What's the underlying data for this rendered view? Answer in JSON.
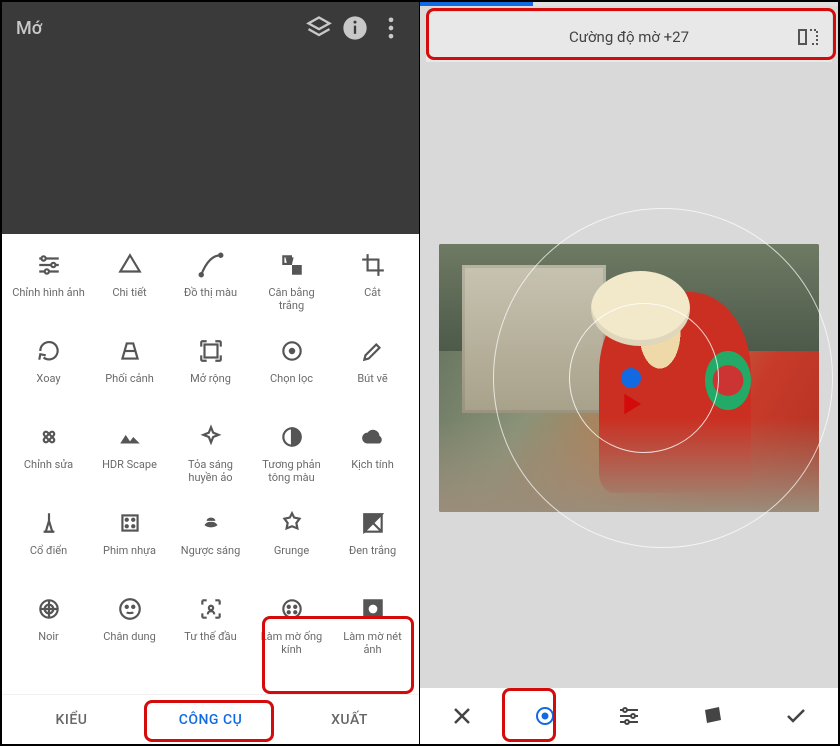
{
  "left": {
    "title": "Mớ",
    "tools": [
      {
        "label": "Chỉnh hình ảnh",
        "name": "tune-image"
      },
      {
        "label": "Chi tiết",
        "name": "details"
      },
      {
        "label": "Đồ thị màu",
        "name": "curves"
      },
      {
        "label": "Cân bằng trắng",
        "name": "white-balance"
      },
      {
        "label": "Cắt",
        "name": "crop"
      },
      {
        "label": "Xoay",
        "name": "rotate"
      },
      {
        "label": "Phối cảnh",
        "name": "perspective"
      },
      {
        "label": "Mở rộng",
        "name": "expand"
      },
      {
        "label": "Chọn lọc",
        "name": "selective"
      },
      {
        "label": "Bút vẽ",
        "name": "brush"
      },
      {
        "label": "Chỉnh sửa",
        "name": "healing"
      },
      {
        "label": "HDR Scape",
        "name": "hdr-scape"
      },
      {
        "label": "Tỏa sáng huyền ảo",
        "name": "glamour-glow"
      },
      {
        "label": "Tương phản tông màu",
        "name": "tonal-contrast"
      },
      {
        "label": "Kịch tính",
        "name": "drama"
      },
      {
        "label": "Cổ điển",
        "name": "vintage"
      },
      {
        "label": "Phim nhựa",
        "name": "grainy-film"
      },
      {
        "label": "Ngược sáng",
        "name": "retrolux"
      },
      {
        "label": "Grunge",
        "name": "grunge"
      },
      {
        "label": "Đen trắng",
        "name": "black-white"
      },
      {
        "label": "Noir",
        "name": "noir"
      },
      {
        "label": "Chân dung",
        "name": "portrait"
      },
      {
        "label": "Tư thế đầu",
        "name": "head-pose"
      },
      {
        "label": "Làm mờ ống kính",
        "name": "lens-blur"
      },
      {
        "label": "Làm mờ nét ảnh",
        "name": "vignette"
      }
    ],
    "tabs": {
      "kieu": "KIỂU",
      "congcu": "CÔNG CỤ",
      "xuat": "XUẤT"
    }
  },
  "right": {
    "blur_label": "Cường độ mờ +27",
    "progress_pct": 27
  }
}
